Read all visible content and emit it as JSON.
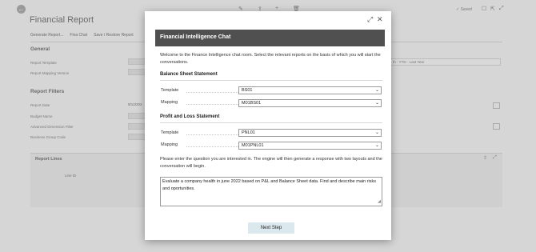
{
  "background": {
    "title": "Financial Report",
    "saved_label": "✓ Saved",
    "actions": [
      "Generate Report...",
      "Fina Chat",
      "Save / Restore Report"
    ],
    "general_section": "General",
    "report_template_label": "Report Template",
    "report_mapping_label": "Report Mapping Version",
    "report_period_value": "th - YTD - Last Year",
    "filters_section": "Report Filters",
    "report_date_label": "Report Date",
    "report_date_value": "9/12/202",
    "budget_name_label": "Budget Name",
    "adv_dim_filter_label": "Advanced Dimension Filter",
    "business_group_label": "Business Group Code",
    "report_lines_title": "Report Lines",
    "line_id_col": "Line ID"
  },
  "modal": {
    "header_title": "Financial Intelligence Chat",
    "intro_text": "Welcome to the Finance Intelligence chat room. Select the relevant reports on the basis of which you will start the conversations.",
    "balance_sheet": {
      "title": "Balance Sheet Statement",
      "template_label": "Template",
      "template_value": "BS01",
      "mapping_label": "Mapping",
      "mapping_value": "M01BS01"
    },
    "profit_loss": {
      "title": "Profit and Loss Statement",
      "template_label": "Template",
      "template_value": "PNL01",
      "mapping_label": "Mapping",
      "mapping_value": "M01PNL01"
    },
    "question_text": "Please enter the question you are interested in. The engine will then generate a response with two layouts and the conversation will begin.",
    "question_value": "Evaluate a company health in june 2022 based on P&L and Balance Sheet data. Find and describe main risks and oportunities.",
    "next_button": "Next Step"
  }
}
